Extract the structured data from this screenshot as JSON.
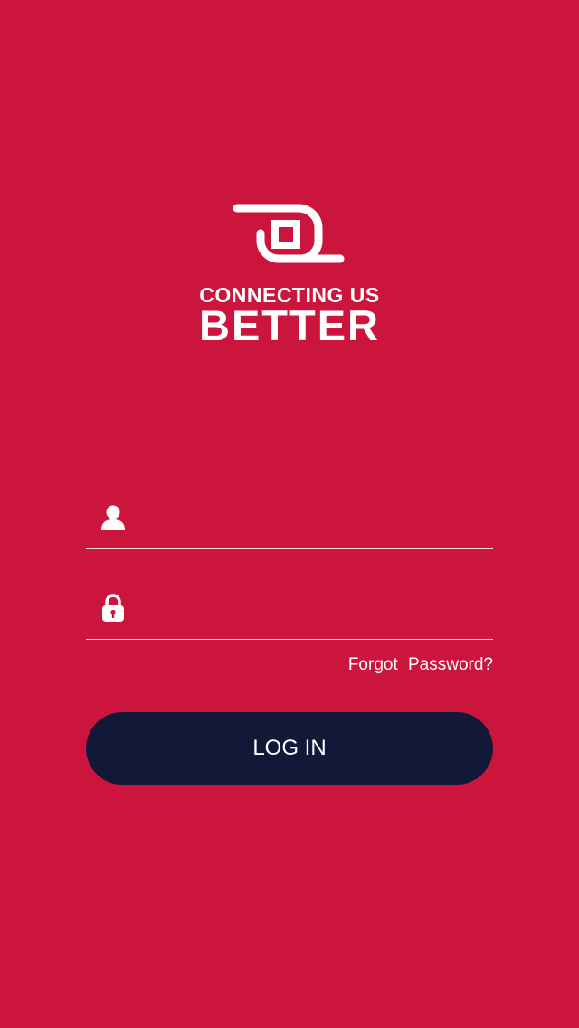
{
  "logo": {
    "icon": "at-sign-logo",
    "tagline_top": "CONNECTING US",
    "tagline_bottom": "BETTER"
  },
  "login_form": {
    "username": {
      "icon": "user-icon",
      "value": "",
      "placeholder": ""
    },
    "password": {
      "icon": "lock-icon",
      "value": "",
      "placeholder": ""
    },
    "forgot_label": "Forgot Password?",
    "submit_label": "LOG IN"
  },
  "colors": {
    "background": "#cc153d",
    "button": "#111838",
    "foreground": "#ffffff"
  }
}
